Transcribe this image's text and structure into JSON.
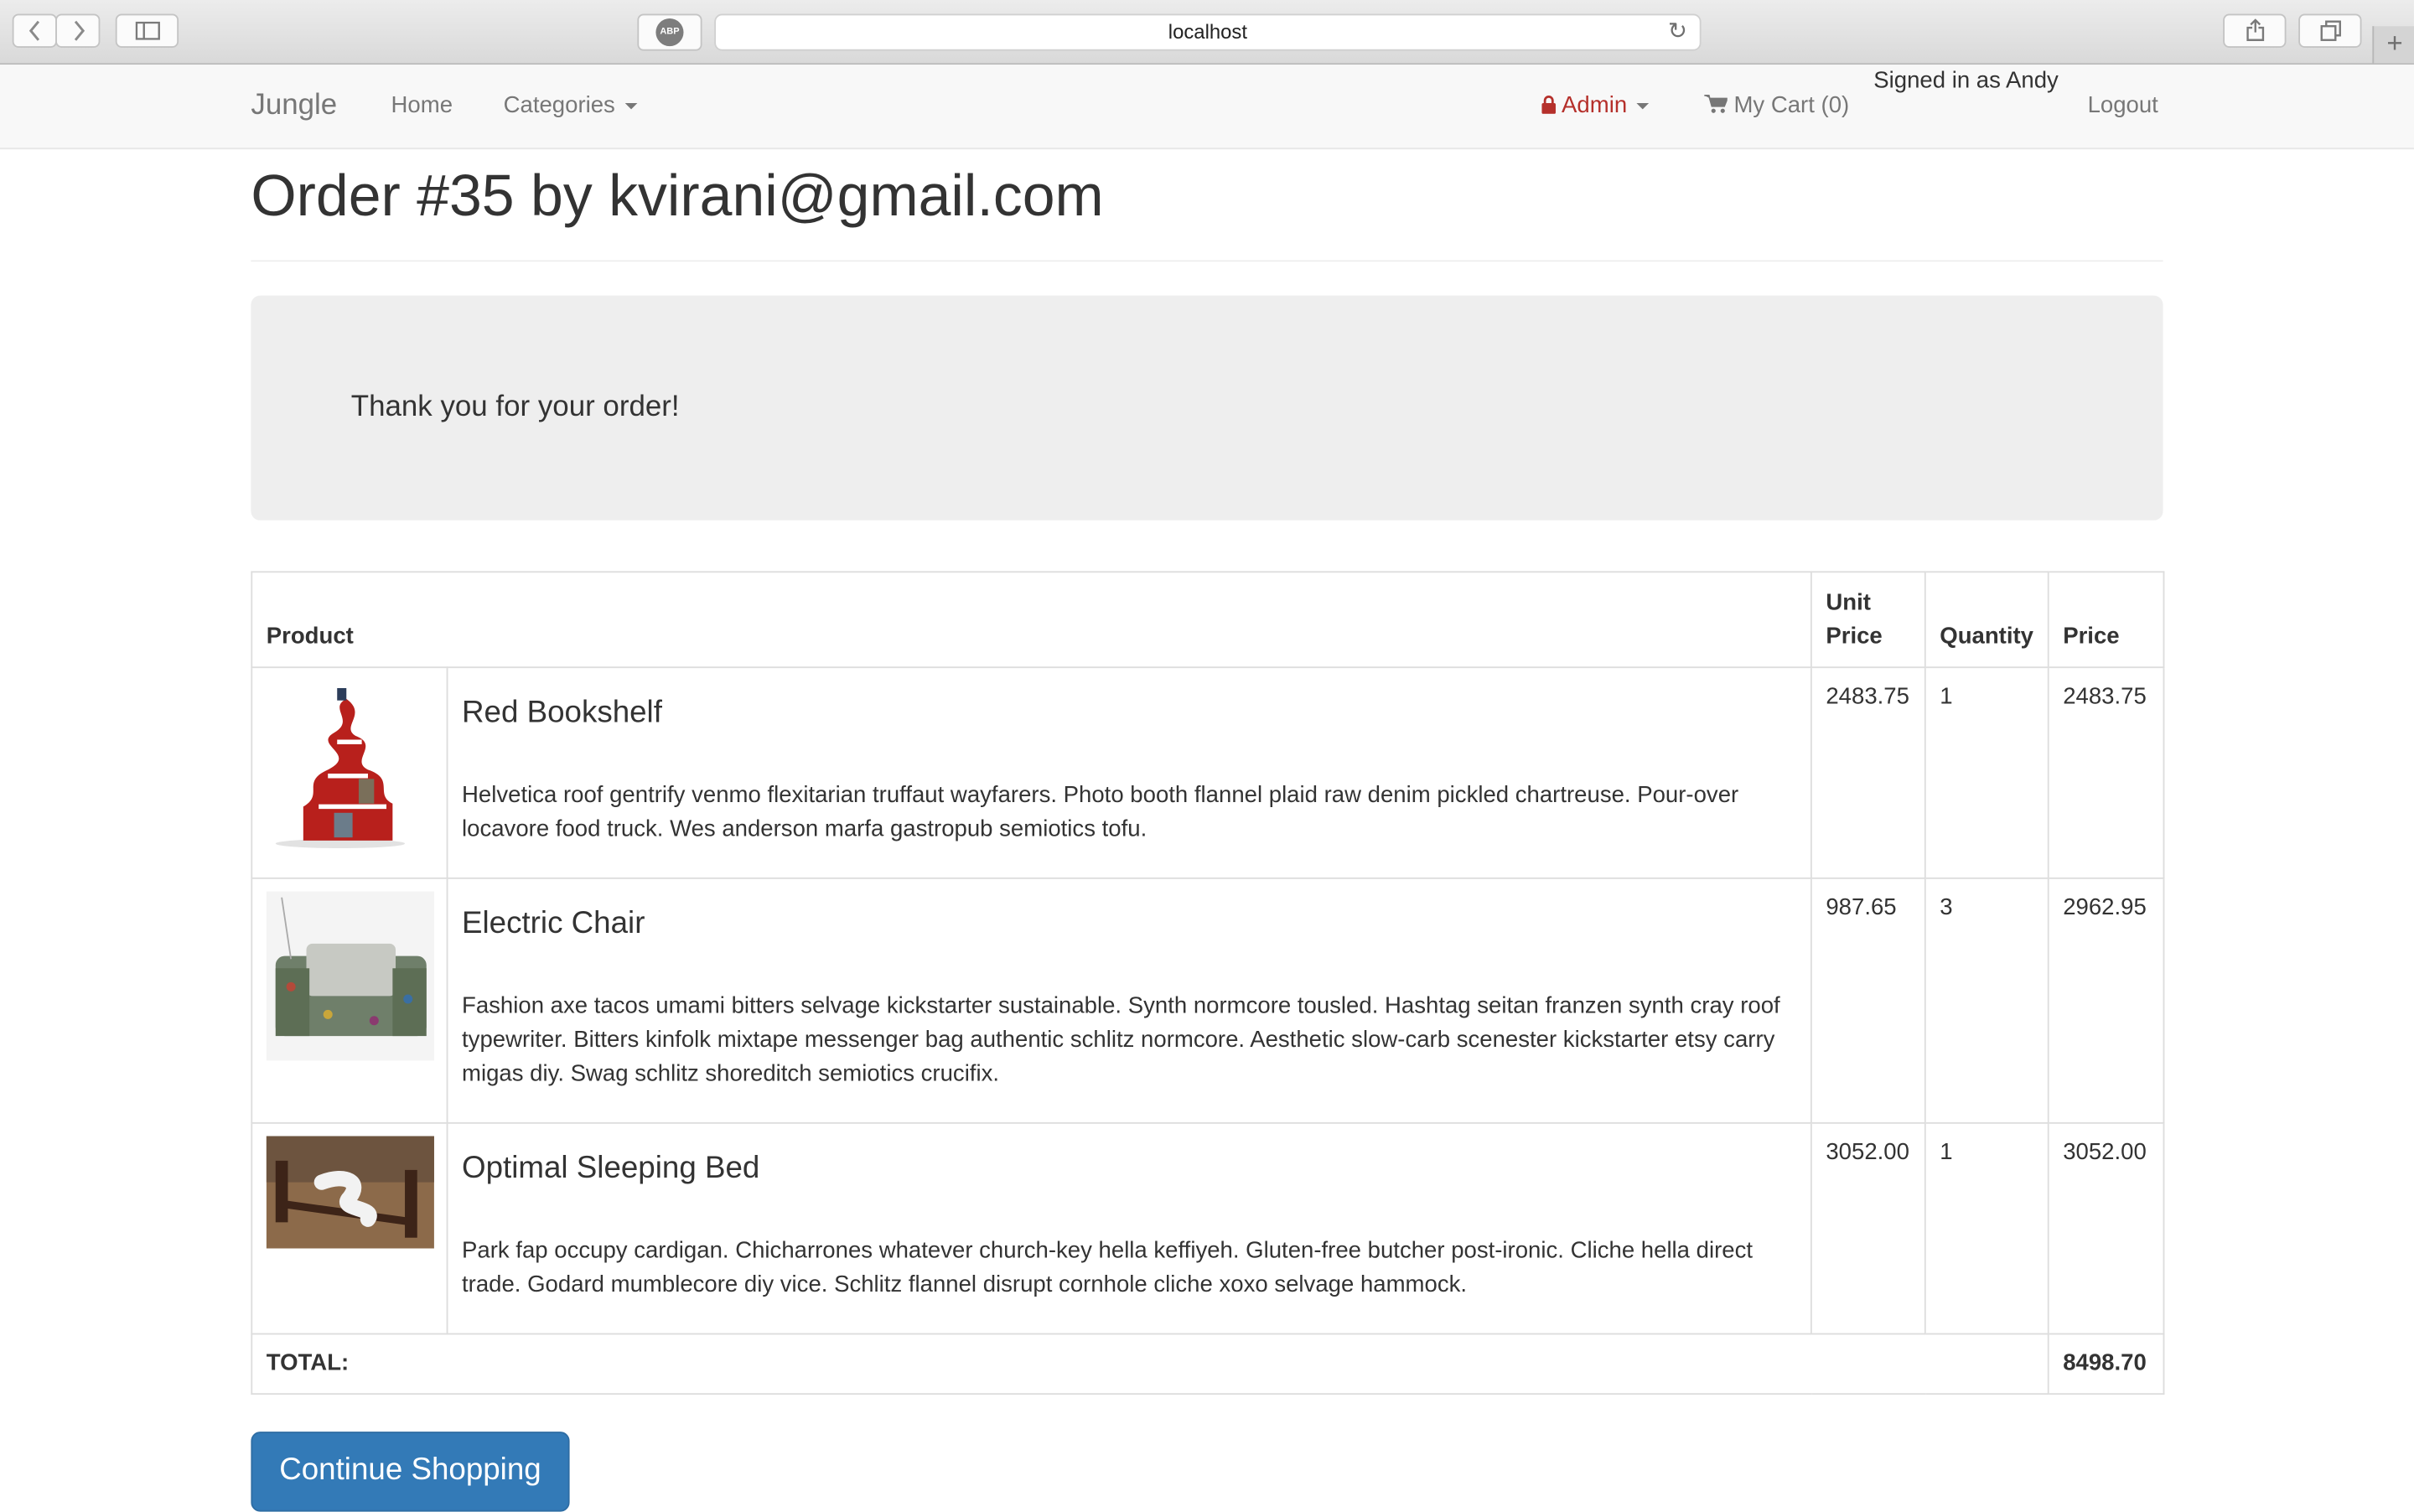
{
  "browser": {
    "address": "localhost",
    "adblock_label": "ABP"
  },
  "navbar": {
    "brand": "Jungle",
    "home": "Home",
    "categories": "Categories",
    "admin": "Admin",
    "cart": "My Cart (0)",
    "signed_in": "Signed in as Andy",
    "logout": "Logout"
  },
  "page": {
    "title": "Order #35 by kvirani@gmail.com",
    "thanks": "Thank you for your order!"
  },
  "table": {
    "headers": {
      "product": "Product",
      "unit_price_1": "Unit",
      "unit_price_2": "Price",
      "quantity": "Quantity",
      "price": "Price"
    },
    "rows": [
      {
        "name": "Red Bookshelf",
        "description": "Helvetica roof gentrify venmo flexitarian truffaut wayfarers. Photo booth flannel plaid raw denim pickled chartreuse. Pour-over locavore food truck. Wes anderson marfa gastropub semiotics tofu.",
        "unit_price": "2483.75",
        "quantity": "1",
        "price": "2483.75"
      },
      {
        "name": "Electric Chair",
        "description": "Fashion axe tacos umami bitters selvage kickstarter sustainable. Synth normcore tousled. Hashtag seitan franzen synth cray roof typewriter. Bitters kinfolk mixtape messenger bag authentic schlitz normcore. Aesthetic slow-carb scenester kickstarter etsy carry migas diy. Swag schlitz shoreditch semiotics crucifix.",
        "unit_price": "987.65",
        "quantity": "3",
        "price": "2962.95"
      },
      {
        "name": "Optimal Sleeping Bed",
        "description": "Park fap occupy cardigan. Chicharrones whatever church-key hella keffiyeh. Gluten-free butcher post-ironic. Cliche hella direct trade. Godard mumblecore diy vice. Schlitz flannel disrupt cornhole cliche xoxo selvage hammock.",
        "unit_price": "3052.00",
        "quantity": "1",
        "price": "3052.00"
      }
    ],
    "total_label": "TOTAL:",
    "total_value": "8498.70"
  },
  "actions": {
    "continue": "Continue Shopping"
  },
  "icons": {
    "back": "chevron-left-icon",
    "forward": "chevron-right-icon",
    "sidebar": "sidebar-icon",
    "reload": "reload-icon",
    "share": "share-icon",
    "tabs": "tabs-icon",
    "new_tab": "plus-icon",
    "lock": "lock-icon",
    "cart": "cart-icon"
  },
  "colors": {
    "primary": "#337ab7",
    "admin": "#b5302b",
    "jumbotron": "#eeeeee",
    "navbar": "#f8f8f8"
  }
}
